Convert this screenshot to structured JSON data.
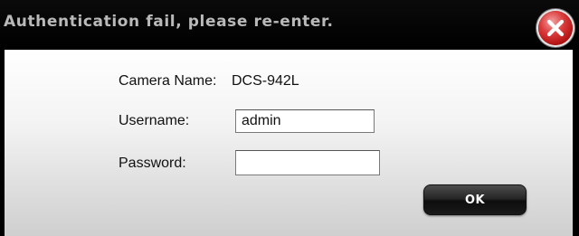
{
  "dialog": {
    "title": "Authentication fail, please re-enter.",
    "close_icon": "close-x-circle-icon"
  },
  "form": {
    "camera_name_label": "Camera Name:",
    "camera_name_value": "DCS-942L",
    "username_label": "Username:",
    "username_value": "admin",
    "password_label": "Password:",
    "password_value": ""
  },
  "buttons": {
    "ok_label": "OK"
  },
  "colors": {
    "close_button": "#cc2222",
    "title_text": "#b9b9b9",
    "ok_button": "#1a1a1a"
  }
}
